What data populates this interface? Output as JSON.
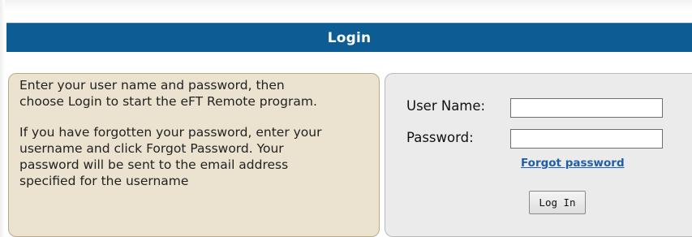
{
  "header": {
    "title": "Login"
  },
  "instructions": {
    "paragraph1": "Enter your user name and password, then\nchoose Login to start the eFT Remote program.",
    "paragraph2": "If you have forgotten your password, enter your\nusername and click Forgot Password. Your\npassword will be sent to the email address\nspecified for the username"
  },
  "form": {
    "username_label": "User Name:",
    "username_value": "",
    "password_label": "Password:",
    "password_value": "",
    "forgot_link": "Forgot password",
    "submit_label": "Log In"
  },
  "colors": {
    "header_bg": "#0d5c93",
    "instructions_bg": "#ebe3cf",
    "form_bg": "#ebebeb",
    "link": "#1f5fa8"
  }
}
